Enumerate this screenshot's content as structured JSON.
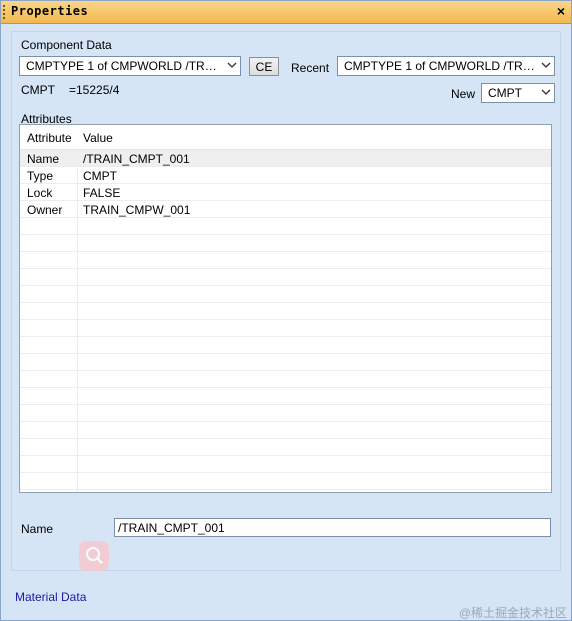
{
  "window": {
    "title": "Properties",
    "close_glyph": "×"
  },
  "component_data": {
    "group_label": "Component Data",
    "element_combo_value": "CMPTYPE 1 of CMPWORLD /TRAIN...",
    "ce_button_label": "CE",
    "recent_label": "Recent",
    "recent_combo_value": "CMPTYPE 1 of CMPWORLD /TRAIN...",
    "type_label": "CMPT",
    "ref_value": "=15225/4",
    "new_label": "New",
    "new_combo_value": "CMPT"
  },
  "attributes": {
    "label": "Attributes",
    "columns": [
      "Attribute",
      "Value"
    ],
    "rows": [
      {
        "attribute": "Name",
        "value": "/TRAIN_CMPT_001"
      },
      {
        "attribute": "Type",
        "value": "CMPT"
      },
      {
        "attribute": "Lock",
        "value": "FALSE"
      },
      {
        "attribute": "Owner",
        "value": "TRAIN_CMPW_001"
      }
    ]
  },
  "name_field": {
    "label": "Name",
    "value": "/TRAIN_CMPT_001"
  },
  "material_link": "Material Data",
  "watermark": "@稀土掘金技术社区",
  "icons": {
    "dropdown": "chevron-down-icon",
    "close": "close-icon",
    "search": "search-icon"
  }
}
